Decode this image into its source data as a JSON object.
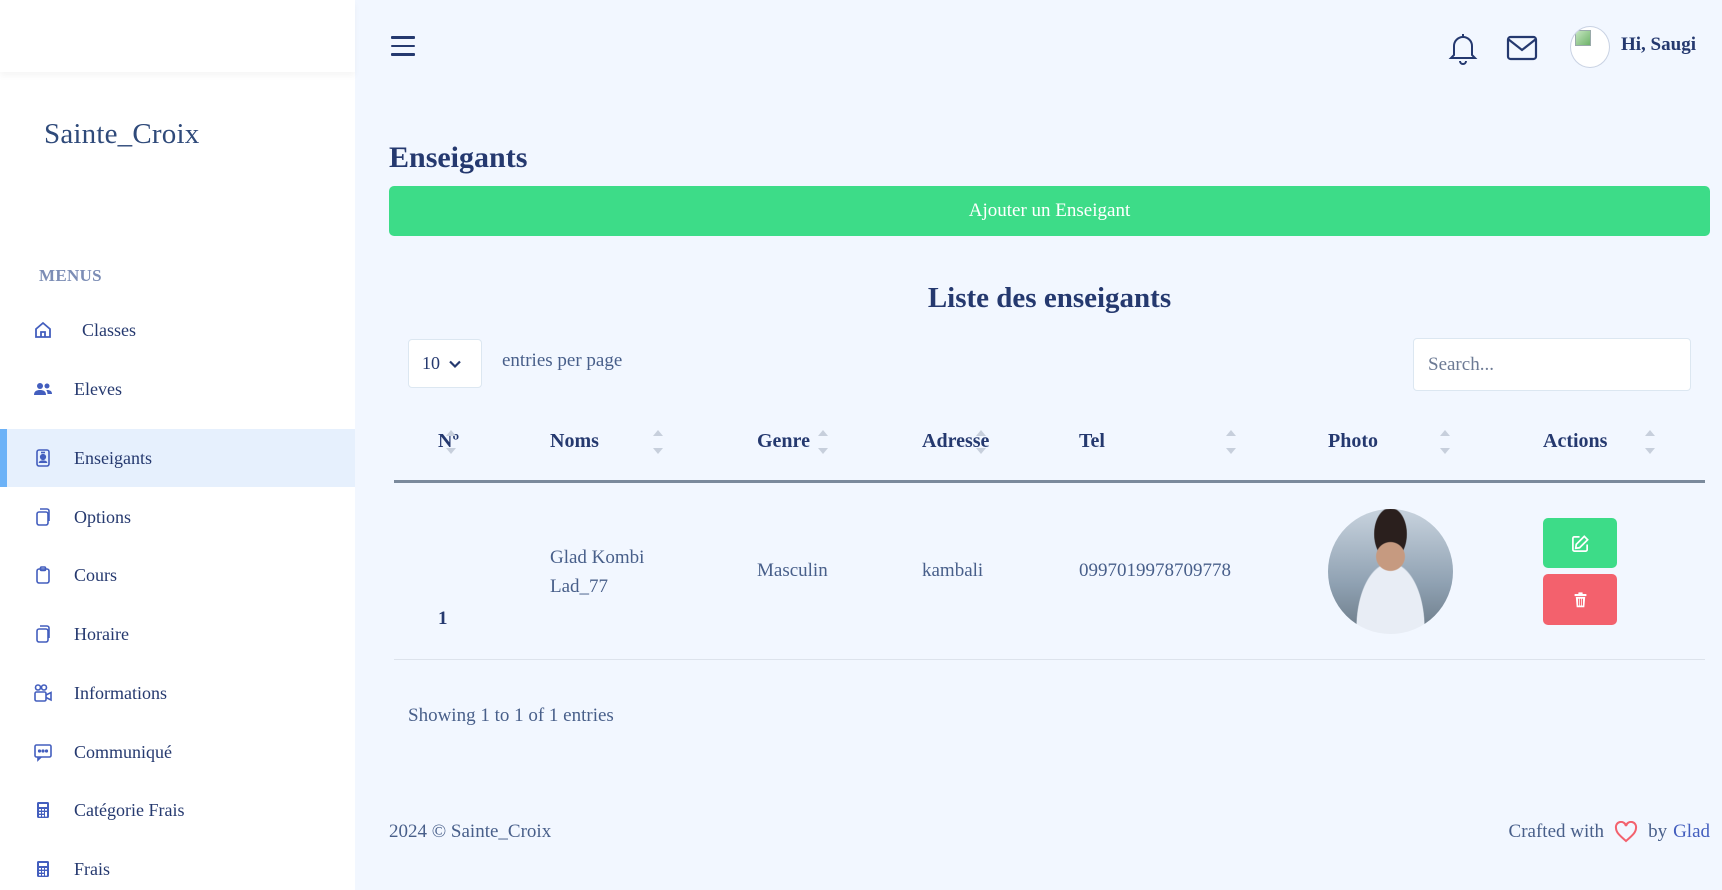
{
  "sidebar": {
    "brand": "Sainte_Croix",
    "menu_title": "MENUS",
    "items": [
      {
        "label": "Classes",
        "icon": "house-icon"
      },
      {
        "label": "Eleves",
        "icon": "people-icon"
      },
      {
        "label": "Enseigants",
        "icon": "person-badge-icon"
      },
      {
        "label": "Options",
        "icon": "collection-icon"
      },
      {
        "label": "Cours",
        "icon": "clipboard-icon"
      },
      {
        "label": "Horaire",
        "icon": "collection-icon"
      },
      {
        "label": "Informations",
        "icon": "camera-video-icon"
      },
      {
        "label": "Communiqué",
        "icon": "chat-dots-icon"
      },
      {
        "label": "Catégorie Frais",
        "icon": "calculator-icon"
      },
      {
        "label": "Frais",
        "icon": "calculator-icon"
      }
    ],
    "active_item": "Enseigants"
  },
  "header": {
    "greeting": "Hi, Saugi"
  },
  "main": {
    "page_title": "Enseigants",
    "add_button": "Ajouter un Enseigant",
    "list_title": "Liste des enseigants",
    "entries_value": "10",
    "entries_label": "entries per page",
    "search_placeholder": "Search...",
    "columns": [
      "Nº",
      "Noms",
      "Genre",
      "Adresse",
      "Tel",
      "Photo",
      "Actions"
    ],
    "rows": [
      {
        "num": "1",
        "name": "Glad Kombi Lad_77",
        "genre": "Masculin",
        "adresse": "kambali",
        "tel": "0997019978709778"
      }
    ],
    "showing": "Showing 1 to 1 of 1 entries"
  },
  "footer": {
    "copyright": "2024 © Sainte_Croix",
    "crafted_prefix": "Crafted with",
    "crafted_by": "by",
    "author": "Glad"
  },
  "colors": {
    "primary": "#435ebe",
    "success": "#3ddc88",
    "danger": "#f3616d",
    "background": "#f2f7ff",
    "active_bg": "#e6f0fd"
  }
}
